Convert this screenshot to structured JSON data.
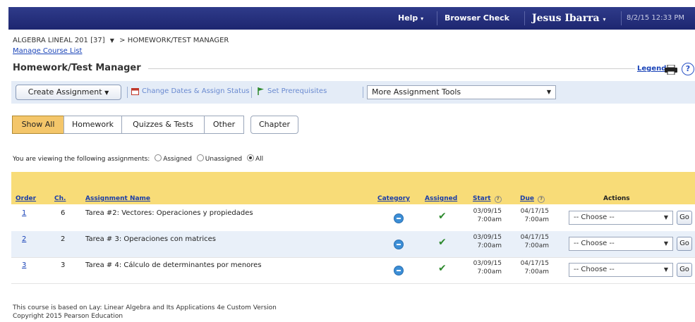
{
  "topbar": {
    "help": "Help",
    "browser_check": "Browser Check",
    "user": "Jesus Ibarra",
    "datetime": "8/2/15 12:33 PM"
  },
  "breadcrumb": {
    "course": "ALGEBRA LINEAL 201 [37]",
    "current": "> HOMEWORK/TEST MANAGER"
  },
  "manage_link": "Manage Course List",
  "page_title": "Homework/Test Manager",
  "legend": "Legend",
  "toolbar": {
    "create": "Create Assignment",
    "change_dates": "Change Dates & Assign Status",
    "prerequisites": "Set Prerequisites",
    "more_tools": "More Assignment Tools"
  },
  "filters": [
    "Show All",
    "Homework",
    "Quizzes & Tests",
    "Other",
    "Chapter"
  ],
  "viewing": {
    "text": "You are viewing the following assignments:",
    "assigned": "Assigned",
    "unassigned": "Unassigned",
    "all": "All",
    "selected": "All"
  },
  "table": {
    "headers": {
      "order": "Order",
      "ch": "Ch.",
      "name": "Assignment Name",
      "category": "Category",
      "assigned": "Assigned",
      "start": "Start",
      "due": "Due",
      "actions": "Actions"
    },
    "rows": [
      {
        "order": "1",
        "ch": "6",
        "name": "Tarea #2: Vectores: Operaciones y propiedades",
        "start_date": "03/09/15",
        "start_time": "7:00am",
        "due_date": "04/17/15",
        "due_time": "7:00am",
        "action": "-- Choose --",
        "go": "Go"
      },
      {
        "order": "2",
        "ch": "2",
        "name": "Tarea # 3: Operaciones con matrices",
        "start_date": "03/09/15",
        "start_time": "7:00am",
        "due_date": "04/17/15",
        "due_time": "7:00am",
        "action": "-- Choose --",
        "go": "Go"
      },
      {
        "order": "3",
        "ch": "3",
        "name": "Tarea # 4: Cálculo de determinantes por menores",
        "start_date": "03/09/15",
        "start_time": "7:00am",
        "due_date": "04/17/15",
        "due_time": "7:00am",
        "action": "-- Choose --",
        "go": "Go"
      }
    ]
  },
  "footer": {
    "line1": "This course is based on Lay: Linear Algebra and Its Applications 4e Custom Version",
    "line2": "Copyright 2015 Pearson Education"
  },
  "colors": {
    "topbar": "#1d2670",
    "toolbar": "#e4ecf7",
    "table_header": "#f8dc78",
    "active_filter": "#f4c66a",
    "link": "#1a44b8"
  },
  "icons": [
    "print-icon",
    "help-icon",
    "calendar-icon",
    "flag-icon",
    "category-icon",
    "checkmark-icon",
    "chevron-down-icon",
    "info-icon"
  ]
}
